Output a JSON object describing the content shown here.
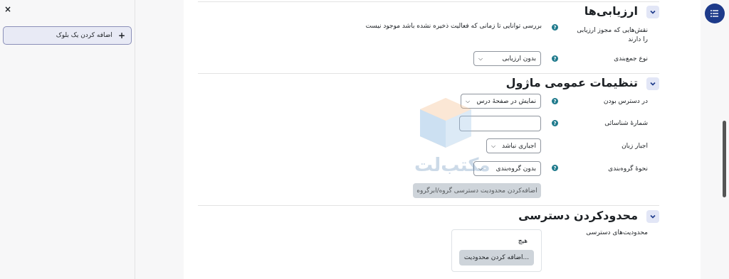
{
  "drawer": {
    "close_label": "×",
    "add_block_label": "اضافه کردن یک بلوک",
    "add_block_icon": "plus-icon"
  },
  "sections": {
    "assessment": {
      "title": "ارزیابی‌ها",
      "roles_label": "نقش‌هایی که مجوز ارزیابی را دارند",
      "roles_value": "بررسی توانایی تا زمانی که فعالیت ذخیره نشده باشد موجود نیست",
      "aggregate_label": "نوع جمع‌بندی",
      "aggregate_value": "بدون ارزیابی"
    },
    "common": {
      "title": "تنظیمات عمومی ماژول",
      "availability_label": "در دسترس بودن",
      "availability_value": "نمایش در صفحهٔ درس",
      "idnumber_label": "شمارهٔ شناسائی",
      "idnumber_value": "",
      "lang_label": "اجبار زبان",
      "lang_value": "اجباری نباشد",
      "groupmode_label": "نحوهٔ گروه‌بندی",
      "groupmode_value": "بدون گروه‌بندی",
      "add_group_restriction_label": "اضافه‌کردن محدودیت دسترسی گروه/ابرگروه"
    },
    "restrict": {
      "title": "محدودکردن دسترسی",
      "restrictions_label": "محدودیت‌های دسترسی",
      "none_text": "هیچ",
      "add_restriction_label": "اضافه کردن محدودیت..."
    }
  },
  "watermark": {
    "text": "مکتب‌لت"
  },
  "colors": {
    "accent": "#1d3a8a",
    "help_icon": "#1f7a8c",
    "chevron_bg": "#e2e6f6"
  }
}
